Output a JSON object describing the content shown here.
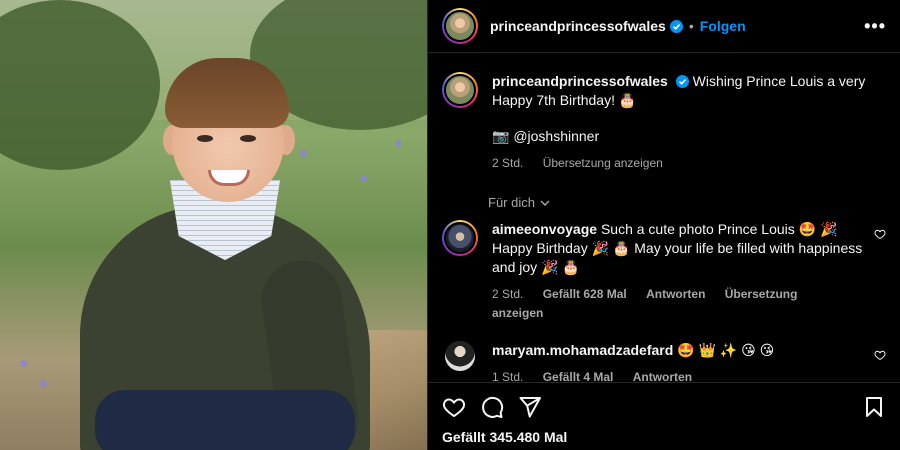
{
  "photo": {
    "alt": "Prince Louis portrait photo"
  },
  "header": {
    "username": "princeandprincessofwales",
    "separator": "•",
    "follow_label": "Folgen",
    "more_icon": "more-icon"
  },
  "caption": {
    "username": "princeandprincessofwales",
    "text": "Wishing Prince Louis a very Happy 7th Birthday! 🎂",
    "credit": "📷 @joshshinner",
    "time": "2 Std.",
    "translate": "Übersetzung anzeigen"
  },
  "for_you": {
    "label": "Für dich",
    "icon": "chevron-down-icon"
  },
  "comments": [
    {
      "username": "aimeeonvoyage",
      "text": "Such a cute photo Prince Louis 🤩 🎉 Happy Birthday 🎉 🎂 May your life be filled with happiness and joy 🎉 🎂",
      "time": "2 Std.",
      "likes": "Gefällt 628 Mal",
      "reply": "Antworten",
      "translate": "Übersetzung anzeigen"
    },
    {
      "username": "maryam.mohamadzadefard",
      "text": "🤩 👑 ✨ 😘 😘",
      "time": "1 Std.",
      "likes": "Gefällt 4 Mal",
      "reply": "Antworten"
    }
  ],
  "footer": {
    "likes_text": "Gefällt 345.480 Mal"
  },
  "colors": {
    "accent": "#0095f6",
    "background": "#000000",
    "secondary_text": "#a8a8a8"
  }
}
